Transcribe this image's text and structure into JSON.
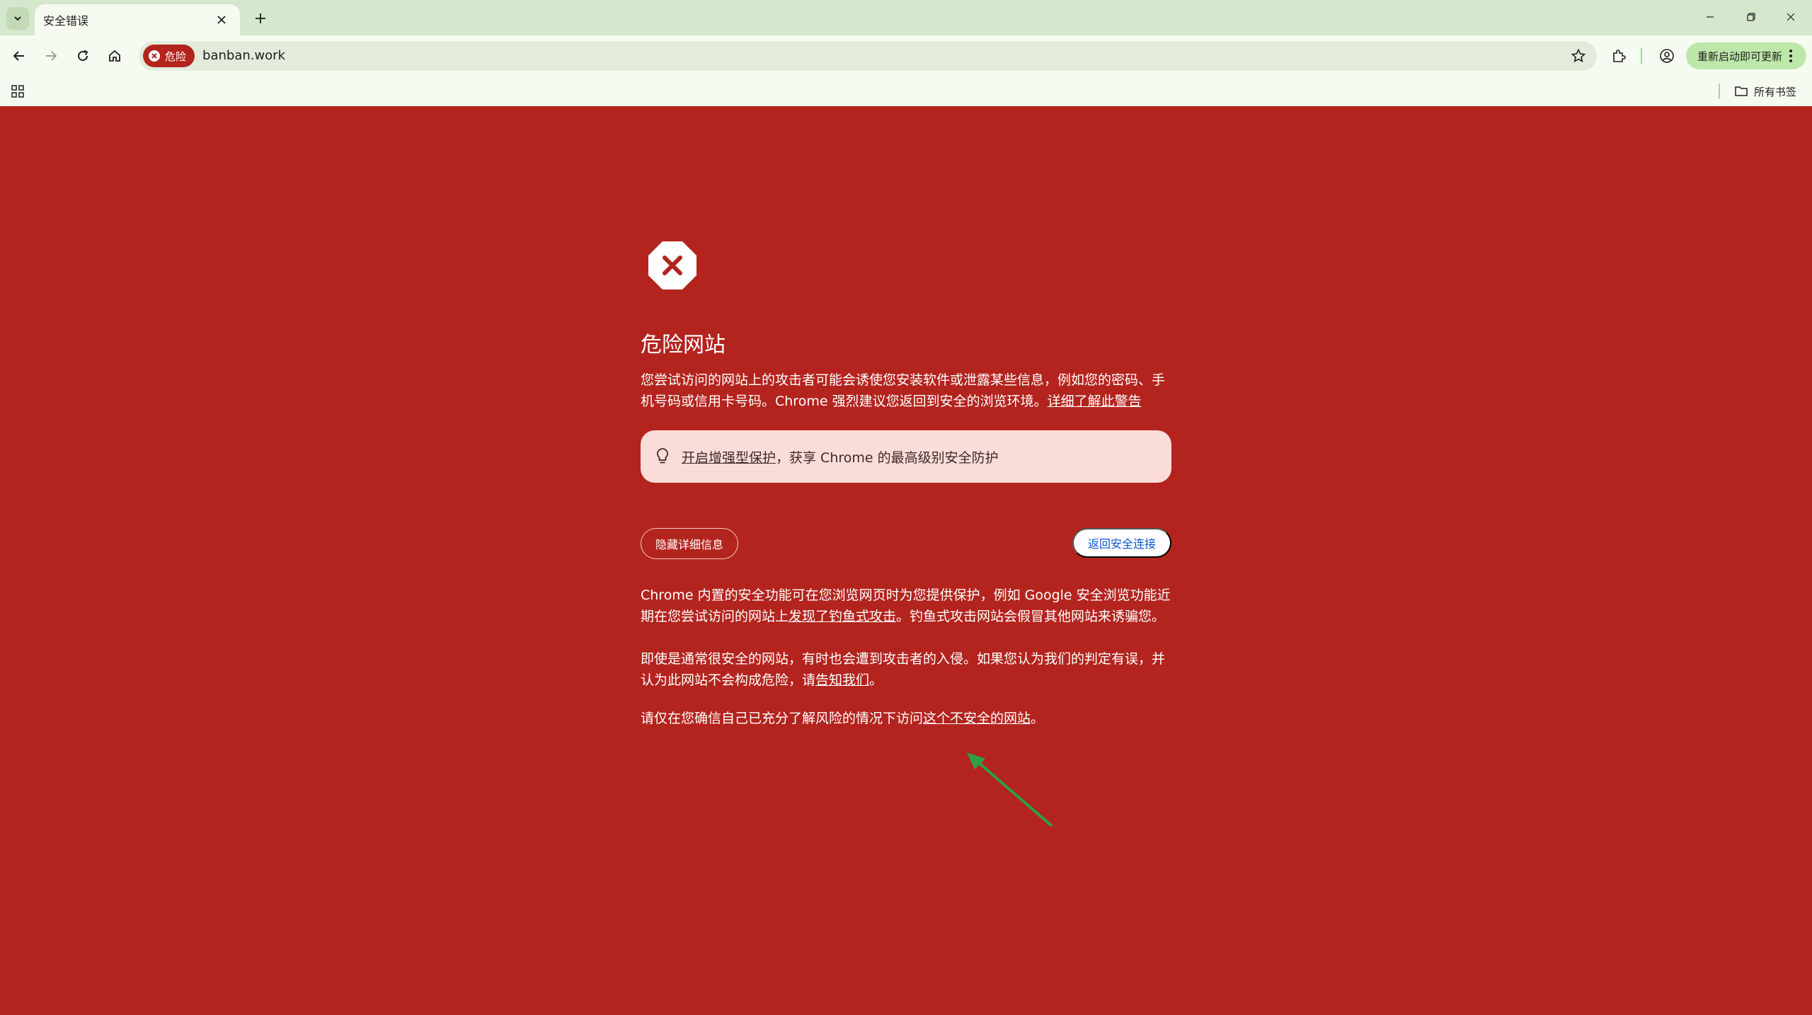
{
  "browser": {
    "tab_title": "安全错误",
    "url": "banban.work",
    "security_chip": "危险",
    "update_button": "重新启动即可更新",
    "all_bookmarks": "所有书签"
  },
  "page": {
    "heading": "危险网站",
    "main_text": "您尝试访问的网站上的攻击者可能会诱使您安装软件或泄露某些信息，例如您的密码、手机号码或信用卡号码。Chrome 强烈建议您返回到安全的浏览环境。",
    "learn_more_link": "详细了解此警告",
    "enhanced_link": "开启增强型保护",
    "enhanced_text": "，获享 Chrome 的最高级别安全防护",
    "hide_details_button": "隐藏详细信息",
    "back_button": "返回安全连接",
    "details_1_prefix": "Chrome 内置的安全功能可在您浏览网页时为您提供保护，例如 Google 安全浏览功能近期在您尝试访问的网站上",
    "details_1_link": "发现了钓鱼式攻击",
    "details_1_suffix": "。钓鱼式攻击网站会假冒其他网站来诱骗您。",
    "details_2_prefix": "即使是通常很安全的网站，有时也会遭到攻击者的入侵。如果您认为我们的判定有误，并认为此网站不会构成危险，请",
    "details_2_link": "告知我们",
    "details_2_suffix": "。",
    "details_3_prefix": "请仅在您确信自己已充分了解风险的情况下访问",
    "details_3_link": "这个不安全的网站",
    "details_3_suffix": "。"
  },
  "colors": {
    "danger_background": "#b3241e",
    "arrow_annotation": "#2ea043",
    "chrome_frame": "#d5e7cc"
  }
}
